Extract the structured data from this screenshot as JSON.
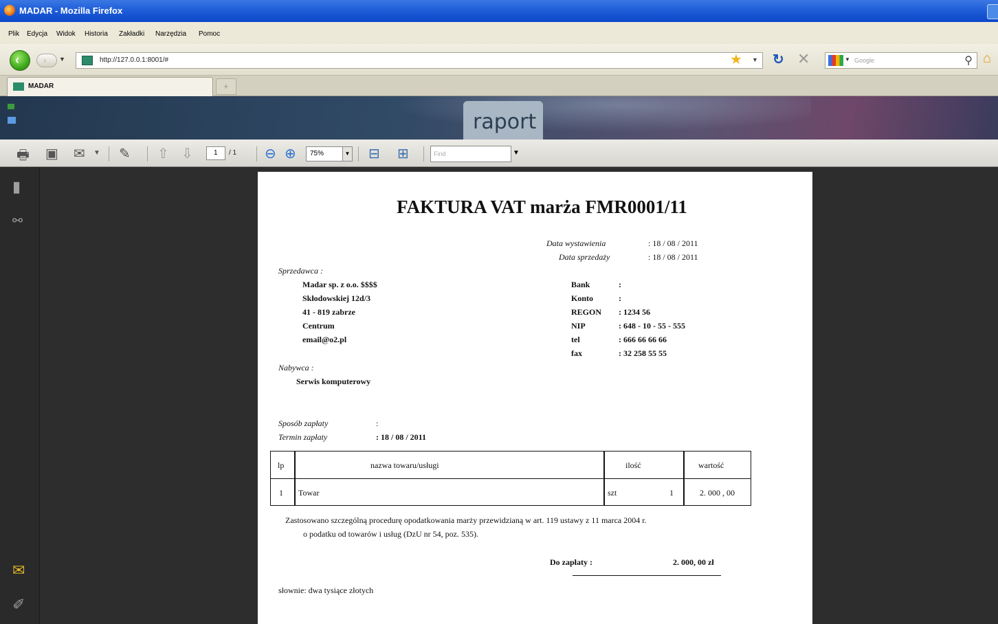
{
  "window": {
    "title": "MADAR - Mozilla Firefox"
  },
  "menu": [
    "Plik",
    "Edycja",
    "Widok",
    "Historia",
    "Zakładki",
    "Narzędzia",
    "Pomoc"
  ],
  "nav": {
    "url": "http://127.0.0.1:8001/#",
    "search_placeholder": "Google"
  },
  "tabs": [
    {
      "label": "MADAR"
    }
  ],
  "app": {
    "active_tab": "raport"
  },
  "pdf_toolbar": {
    "page_current": "1",
    "page_total": "/ 1",
    "zoom": "75%",
    "find_placeholder": "Find"
  },
  "invoice": {
    "title": "FAKTURA VAT marża FMR0001/11",
    "issue_date_label": "Data wystawienia",
    "issue_date": ":  18 / 08 / 2011",
    "sale_date_label": "Data sprzedaży",
    "sale_date": ":  18 / 08 / 2011",
    "seller_label": "Sprzedawca :",
    "seller_lines": [
      "Madar sp. z o.o.  $$$$",
      "Skłodowskiej 12d/3",
      "41 - 819  zabrze",
      "Centrum",
      "email@o2.pl"
    ],
    "company_info": [
      {
        "label": "Bank",
        "value": ":"
      },
      {
        "label": "Konto",
        "value": ":"
      },
      {
        "label": "REGON",
        "value": ":  1234 56"
      },
      {
        "label": "NIP",
        "value": ":  648 - 10 - 55 - 555"
      },
      {
        "label": "tel",
        "value": ":  666  66  66  66"
      },
      {
        "label": "fax",
        "value": ":  32  258  55  55"
      }
    ],
    "buyer_label": "Nabywca    :",
    "buyer_name": "Serwis komputerowy",
    "payment_method_label": "Sposób zapłaty",
    "payment_method_value": ":",
    "payment_due_label": "Termin zapłaty",
    "payment_due_value": ":   18 / 08 / 2011",
    "table": {
      "headers": [
        "lp",
        "nazwa towaru/usługi",
        "ilość",
        "wartość"
      ],
      "rows": [
        {
          "lp": "1",
          "name": "Towar",
          "unit": "szt",
          "qty": "1",
          "value": "2. 000 , 00"
        }
      ]
    },
    "note_line1": "Zastosowano szczególną procedurę opodatkowania marży przewidzianą w art. 119 ustawy z 11 marca 2004  r.",
    "note_line2": "o podatku od towarów i usług  (DzU nr 54, poz. 535).",
    "total_label": "Do zapłaty :",
    "total_value": "2. 000, 00  zł",
    "in_words": "słownie: dwa tysiące złotych"
  }
}
